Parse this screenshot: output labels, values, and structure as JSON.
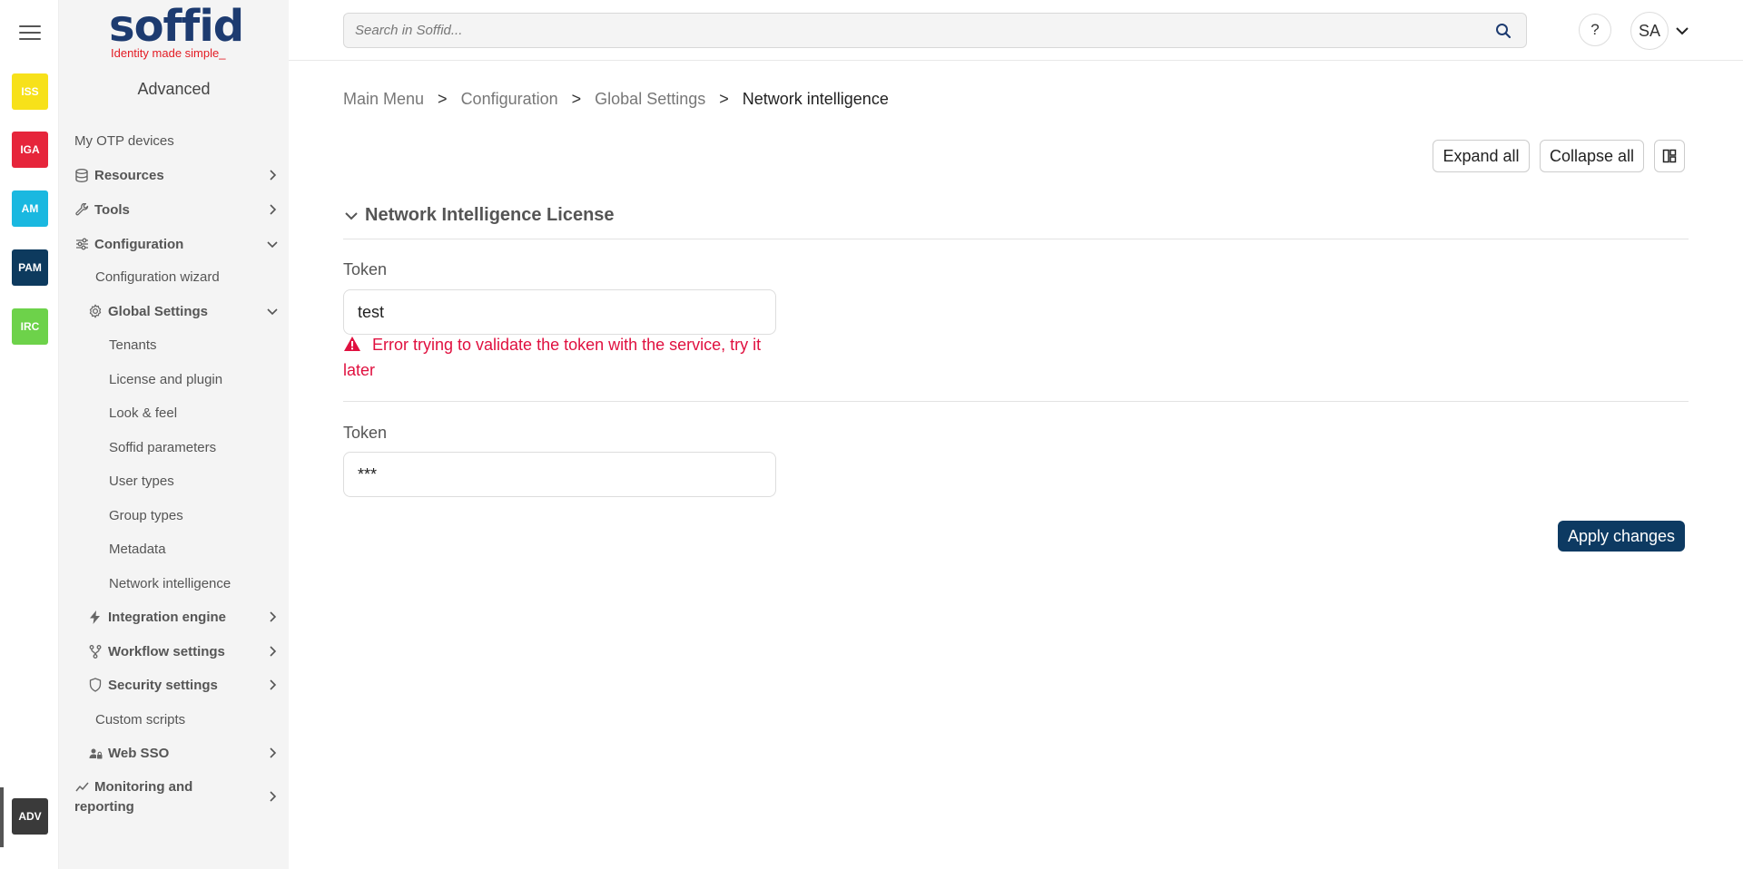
{
  "rail": {
    "apps": [
      {
        "label": "ISS",
        "color": "#f7e11a",
        "text_color": "#ffffff"
      },
      {
        "label": "IGA",
        "color": "#e6253b",
        "text_color": "#ffffff"
      },
      {
        "label": "AM",
        "color": "#1ab8e0",
        "text_color": "#ffffff"
      },
      {
        "label": "PAM",
        "color": "#0d3a5e",
        "text_color": "#ffffff"
      },
      {
        "label": "IRC",
        "color": "#6dd24a",
        "text_color": "#ffffff"
      },
      {
        "label": "ADV",
        "color": "#3a3a3a",
        "text_color": "#ffffff"
      }
    ]
  },
  "sidebar": {
    "logo_word": "soffid",
    "logo_tagline": "Identity made simple_",
    "title": "Advanced",
    "items": [
      {
        "label": "My OTP devices",
        "icon": "",
        "bold": false
      },
      {
        "label": "Resources",
        "icon": "database-icon",
        "bold": true,
        "chevron": "right"
      },
      {
        "label": "Tools",
        "icon": "wrench-icon",
        "bold": true,
        "chevron": "right"
      },
      {
        "label": "Configuration",
        "icon": "sliders-icon",
        "bold": true,
        "chevron": "down"
      },
      {
        "label": "Configuration wizard",
        "icon": "",
        "bold": false
      },
      {
        "label": "Global Settings",
        "icon": "gear-icon",
        "bold": true,
        "chevron": "down"
      },
      {
        "label": "Tenants",
        "icon": "",
        "bold": false
      },
      {
        "label": "License and plugin",
        "icon": "",
        "bold": false
      },
      {
        "label": "Look & feel",
        "icon": "",
        "bold": false
      },
      {
        "label": "Soffid parameters",
        "icon": "",
        "bold": false
      },
      {
        "label": "User types",
        "icon": "",
        "bold": false
      },
      {
        "label": "Group types",
        "icon": "",
        "bold": false
      },
      {
        "label": "Metadata",
        "icon": "",
        "bold": false
      },
      {
        "label": "Network intelligence",
        "icon": "",
        "bold": false
      },
      {
        "label": "Integration engine",
        "icon": "bolt-icon",
        "bold": true,
        "chevron": "right"
      },
      {
        "label": "Workflow settings",
        "icon": "fork-icon",
        "bold": true,
        "chevron": "right"
      },
      {
        "label": "Security settings",
        "icon": "shield-icon",
        "bold": true,
        "chevron": "right"
      },
      {
        "label": "Custom scripts",
        "icon": "",
        "bold": false
      },
      {
        "label": "Web SSO",
        "icon": "user-lock-icon",
        "bold": true,
        "chevron": "right"
      },
      {
        "label": "Monitoring and",
        "label2": "reporting",
        "icon": "chart-line-icon",
        "bold": true,
        "chevron": "right"
      }
    ]
  },
  "topbar": {
    "search_placeholder": "Search in Soffid...",
    "help_label": "?",
    "avatar_initials": "SA"
  },
  "breadcrumb": {
    "items": [
      "Main Menu",
      "Configuration",
      "Global Settings",
      "Network intelligence"
    ],
    "separator": ">"
  },
  "toolbar": {
    "expand_label": "Expand all",
    "collapse_label": "Collapse all"
  },
  "section": {
    "title": "Network Intelligence License",
    "field1_label": "Token",
    "field1_value": "test",
    "error_text": "Error trying to validate the token with the service, try it later",
    "field2_label": "Token",
    "field2_value": "***"
  },
  "actions": {
    "apply_label": "Apply changes"
  },
  "colors": {
    "brand": "#1d3b70",
    "error": "#e0103f",
    "primary_button": "#0d3a62"
  }
}
